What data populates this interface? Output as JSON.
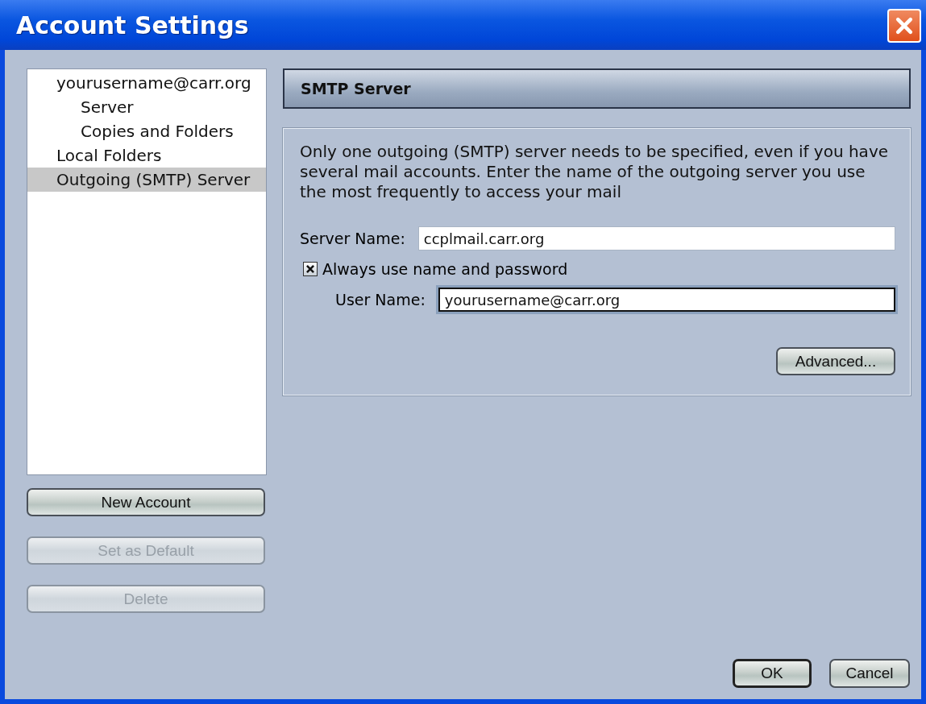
{
  "window": {
    "title": "Account Settings"
  },
  "account_tree": [
    {
      "label": "yourusername@carr.org",
      "selected": false,
      "children": [
        {
          "label": "Server",
          "selected": false
        },
        {
          "label": "Copies and Folders",
          "selected": false
        }
      ]
    },
    {
      "label": "Local Folders",
      "selected": false
    },
    {
      "label": "Outgoing (SMTP) Server",
      "selected": true
    }
  ],
  "account_buttons": [
    {
      "label": "New Account",
      "disabled": false
    },
    {
      "label": "Set as Default",
      "disabled": true
    },
    {
      "label": "Delete",
      "disabled": true
    }
  ],
  "panel": {
    "title": "SMTP Server",
    "description": "Only one outgoing (SMTP) server needs to be specified, even if you have several mail accounts. Enter the name of the outgoing server you use the most frequently to access your mail",
    "server_name": {
      "label": "Server Name:",
      "value": "ccplmail.carr.org",
      "focused": false
    },
    "always_use_name": {
      "label": "Always use name and password",
      "checked": true
    },
    "user_name": {
      "label": "User Name:",
      "value": "yourusername@carr.org",
      "focused": true
    },
    "advanced_button": "Advanced..."
  },
  "dialog_buttons": [
    {
      "label": "OK",
      "default": true
    },
    {
      "label": "Cancel",
      "default": false
    }
  ]
}
